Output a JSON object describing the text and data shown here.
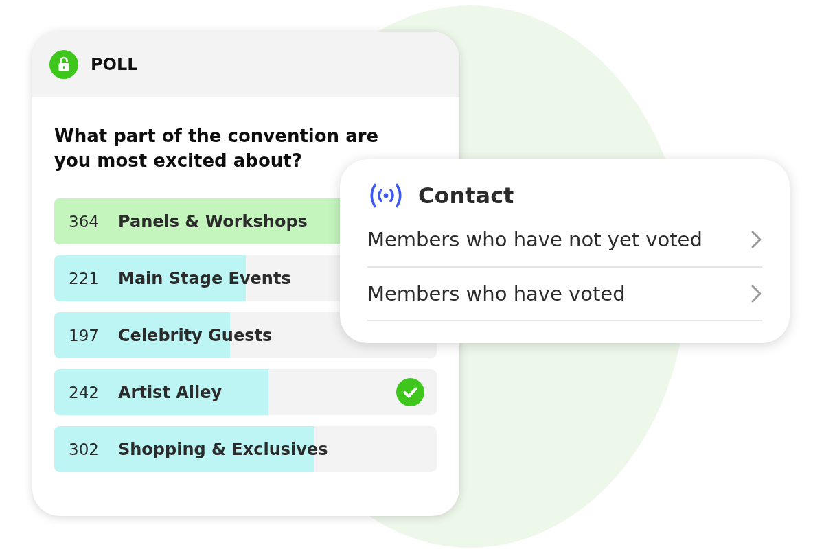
{
  "poll": {
    "title": "POLL",
    "question": "What part of the convention are you most excited about?",
    "options": [
      {
        "count": "364",
        "label": "Panels & Workshops",
        "level": 0.83,
        "color": "#c4f5bd",
        "voted": false
      },
      {
        "count": "221",
        "label": "Main Stage Events",
        "level": 0.5,
        "color": "#bcf5f3",
        "voted": false
      },
      {
        "count": "197",
        "label": "Celebrity Guests",
        "level": 0.46,
        "color": "#bcf5f3",
        "voted": false
      },
      {
        "count": "242",
        "label": "Artist Alley",
        "level": 0.56,
        "color": "#bcf5f3",
        "voted": true
      },
      {
        "count": "302",
        "label": "Shopping & Exclusives",
        "level": 0.68,
        "color": "#bcf5f3",
        "voted": false
      }
    ]
  },
  "contact": {
    "title": "Contact",
    "items": [
      {
        "label": "Members who have not yet voted"
      },
      {
        "label": "Members who have voted"
      }
    ]
  }
}
